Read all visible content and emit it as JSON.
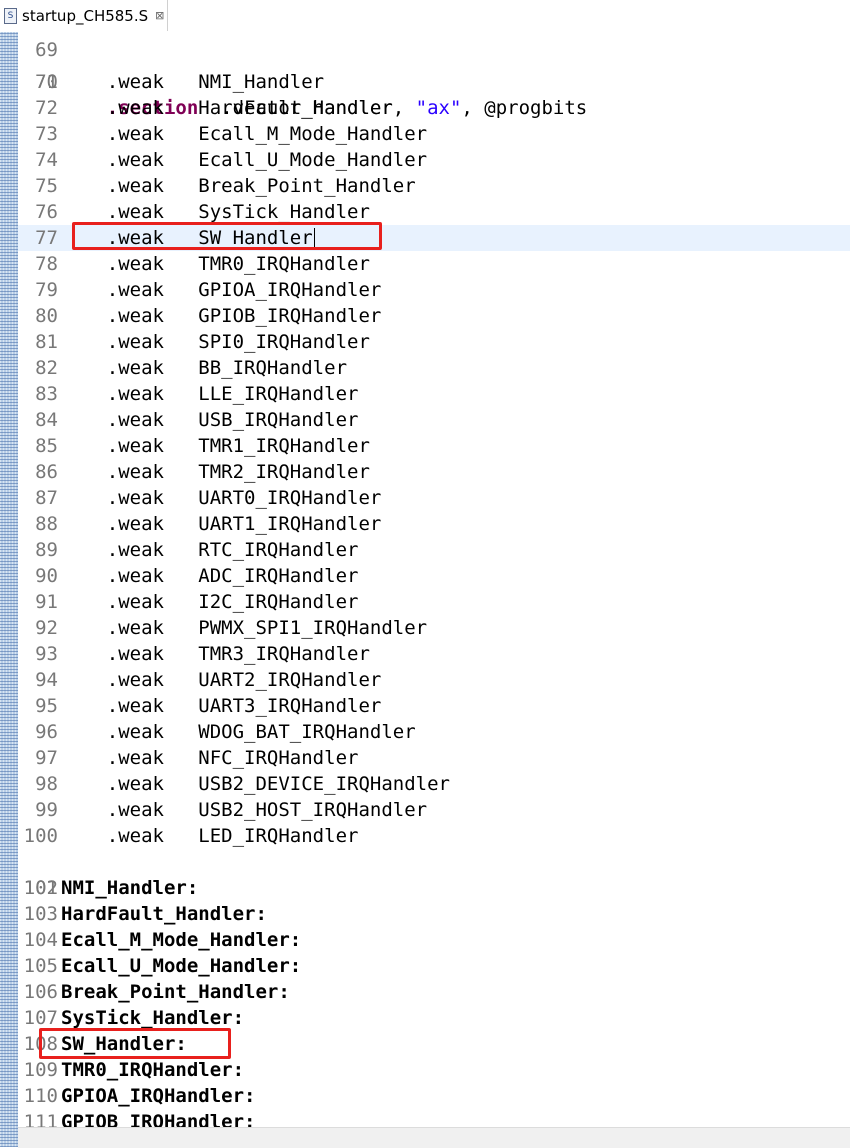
{
  "editor_tab": {
    "icon": "assembly-file-icon",
    "icon_glyph": "S",
    "title": "startup_CH585.S",
    "close_glyph": "⊠"
  },
  "section_line": {
    "number": "70",
    "keyword": ".section",
    "args": "  .vector_handler, ",
    "string": "\"ax\"",
    "rest": ", @progbits"
  },
  "weak_lines": [
    {
      "number": "71",
      "keyword": ".weak",
      "symbol": "NMI_Handler"
    },
    {
      "number": "72",
      "keyword": ".weak",
      "symbol": "HardFault_Handler"
    },
    {
      "number": "73",
      "keyword": ".weak",
      "symbol": "Ecall_M_Mode_Handler"
    },
    {
      "number": "74",
      "keyword": ".weak",
      "symbol": "Ecall_U_Mode_Handler"
    },
    {
      "number": "75",
      "keyword": ".weak",
      "symbol": "Break_Point_Handler"
    },
    {
      "number": "76",
      "keyword": ".weak",
      "symbol": "SysTick_Handler"
    },
    {
      "number": "77",
      "keyword": ".weak",
      "symbol": "SW_Handler"
    },
    {
      "number": "78",
      "keyword": ".weak",
      "symbol": "TMR0_IRQHandler"
    },
    {
      "number": "79",
      "keyword": ".weak",
      "symbol": "GPIOA_IRQHandler"
    },
    {
      "number": "80",
      "keyword": ".weak",
      "symbol": "GPIOB_IRQHandler"
    },
    {
      "number": "81",
      "keyword": ".weak",
      "symbol": "SPI0_IRQHandler"
    },
    {
      "number": "82",
      "keyword": ".weak",
      "symbol": "BB_IRQHandler"
    },
    {
      "number": "83",
      "keyword": ".weak",
      "symbol": "LLE_IRQHandler"
    },
    {
      "number": "84",
      "keyword": ".weak",
      "symbol": "USB_IRQHandler"
    },
    {
      "number": "85",
      "keyword": ".weak",
      "symbol": "TMR1_IRQHandler"
    },
    {
      "number": "86",
      "keyword": ".weak",
      "symbol": "TMR2_IRQHandler"
    },
    {
      "number": "87",
      "keyword": ".weak",
      "symbol": "UART0_IRQHandler"
    },
    {
      "number": "88",
      "keyword": ".weak",
      "symbol": "UART1_IRQHandler"
    },
    {
      "number": "89",
      "keyword": ".weak",
      "symbol": "RTC_IRQHandler"
    },
    {
      "number": "90",
      "keyword": ".weak",
      "symbol": "ADC_IRQHandler"
    },
    {
      "number": "91",
      "keyword": ".weak",
      "symbol": "I2C_IRQHandler"
    },
    {
      "number": "92",
      "keyword": ".weak",
      "symbol": "PWMX_SPI1_IRQHandler"
    },
    {
      "number": "93",
      "keyword": ".weak",
      "symbol": "TMR3_IRQHandler"
    },
    {
      "number": "94",
      "keyword": ".weak",
      "symbol": "UART2_IRQHandler"
    },
    {
      "number": "95",
      "keyword": ".weak",
      "symbol": "UART3_IRQHandler"
    },
    {
      "number": "96",
      "keyword": ".weak",
      "symbol": "WDOG_BAT_IRQHandler"
    },
    {
      "number": "97",
      "keyword": ".weak",
      "symbol": "NFC_IRQHandler"
    },
    {
      "number": "98",
      "keyword": ".weak",
      "symbol": "USB2_DEVICE_IRQHandler"
    },
    {
      "number": "99",
      "keyword": ".weak",
      "symbol": "USB2_HOST_IRQHandler"
    },
    {
      "number": "100",
      "keyword": ".weak",
      "symbol": "LED_IRQHandler"
    }
  ],
  "blank_line": {
    "number": "101"
  },
  "label_lines": [
    {
      "number": "102",
      "label": "NMI_Handler:"
    },
    {
      "number": "103",
      "label": "HardFault_Handler:"
    },
    {
      "number": "104",
      "label": "Ecall_M_Mode_Handler:"
    },
    {
      "number": "105",
      "label": "Ecall_U_Mode_Handler:"
    },
    {
      "number": "106",
      "label": "Break_Point_Handler:"
    },
    {
      "number": "107",
      "label": "SysTick_Handler:"
    },
    {
      "number": "108",
      "label": "SW_Handler:"
    },
    {
      "number": "109",
      "label": "TMR0_IRQHandler:"
    },
    {
      "number": "110",
      "label": "GPIOA_IRQHandler:"
    },
    {
      "number": "111",
      "label": "GPIOB_IRQHandler:"
    }
  ],
  "annotation_color": "#e8201d",
  "current_line_color": "#e8f2fe"
}
